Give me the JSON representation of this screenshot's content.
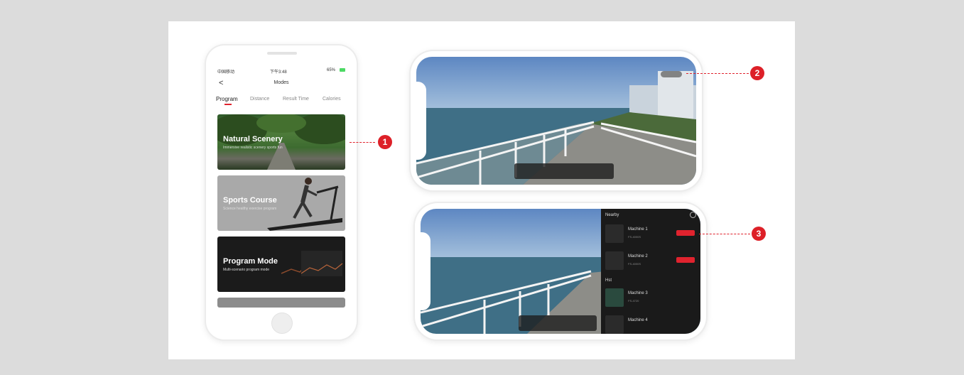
{
  "phone": {
    "status": {
      "carrier": "中国移动",
      "time": "下午3:48",
      "battery": "65%"
    },
    "nav": {
      "back": "<",
      "title": "Modes"
    },
    "tabs": [
      "Program",
      "Distance",
      "Result Time",
      "Calories"
    ],
    "modes": [
      {
        "title": "Natural Scenery",
        "subtitle": "Immersive realistic scenery sports fun"
      },
      {
        "title": "Sports Course",
        "subtitle": "Science healthy exercise program"
      },
      {
        "title": "Program Mode",
        "subtitle": "Multi-scenario program mode"
      }
    ]
  },
  "panel": {
    "nearby_label": "Nearby",
    "history_label": "Hst",
    "machines": [
      {
        "name": "Machine 1",
        "id": "FS-4000S"
      },
      {
        "name": "Machine 2",
        "id": "FS-4000S"
      },
      {
        "name": "Machine 3",
        "id": "FS-4720"
      },
      {
        "name": "Machine 4",
        "id": ""
      }
    ]
  },
  "callouts": [
    "1",
    "2",
    "3"
  ],
  "colors": {
    "accent": "#e0232e",
    "badge": "#dd2028"
  }
}
